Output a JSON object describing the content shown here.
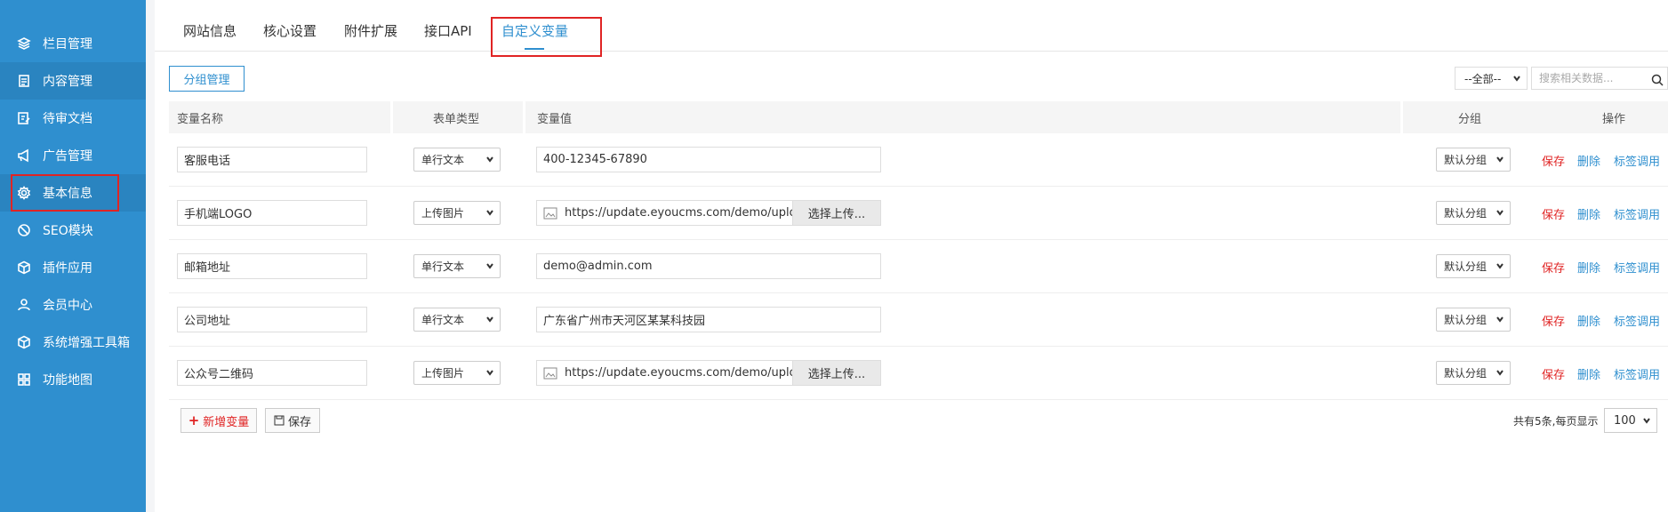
{
  "sidebar": {
    "items": [
      {
        "label": "栏目管理",
        "icon": "layers-icon"
      },
      {
        "label": "内容管理",
        "icon": "document-icon"
      },
      {
        "label": "待审文档",
        "icon": "edit-document-icon"
      },
      {
        "label": "广告管理",
        "icon": "megaphone-icon"
      },
      {
        "label": "基本信息",
        "icon": "gear-icon"
      },
      {
        "label": "SEO模块",
        "icon": "seo-icon"
      },
      {
        "label": "插件应用",
        "icon": "cube-icon"
      },
      {
        "label": "会员中心",
        "icon": "user-icon"
      },
      {
        "label": "系统增强工具箱",
        "icon": "toolbox-icon"
      },
      {
        "label": "功能地图",
        "icon": "grid-icon"
      }
    ],
    "active_index": 4
  },
  "tabs": [
    {
      "label": "网站信息"
    },
    {
      "label": "核心设置"
    },
    {
      "label": "附件扩展"
    },
    {
      "label": "接口API"
    },
    {
      "label": "自定义变量"
    }
  ],
  "toolbar": {
    "group_button": "分组管理",
    "filter_value": "--全部--",
    "search_placeholder": "搜索相关数据..."
  },
  "table": {
    "headers": [
      "变量名称",
      "表单类型",
      "变量值",
      "分组",
      "操作"
    ],
    "rows": [
      {
        "name": "客服电话",
        "type": "单行文本",
        "value": "400-12345-67890",
        "is_image": false,
        "group": "默认分组"
      },
      {
        "name": "手机端LOGO",
        "type": "上传图片",
        "value": "https://update.eyoucms.com/demo/uploa",
        "is_image": true,
        "group": "默认分组"
      },
      {
        "name": "邮箱地址",
        "type": "单行文本",
        "value": "demo@admin.com",
        "is_image": false,
        "group": "默认分组"
      },
      {
        "name": "公司地址",
        "type": "单行文本",
        "value": "广东省广州市天河区某某科技园",
        "is_image": false,
        "group": "默认分组"
      },
      {
        "name": "公众号二维码",
        "type": "上传图片",
        "value": "https://update.eyoucms.com/demo/uploa",
        "is_image": true,
        "group": "默认分组"
      }
    ],
    "upload_label": "选择上传...",
    "actions": {
      "save": "保存",
      "delete": "删除",
      "tag": "标签调用"
    }
  },
  "footer": {
    "add_button": "新增变量",
    "save_button": "保存",
    "pager_text": "共有5条,每页显示",
    "page_size": "100"
  },
  "colors": {
    "sidebar": "#2f8fcf",
    "accent": "#2f8fcf",
    "danger": "#e02424"
  }
}
